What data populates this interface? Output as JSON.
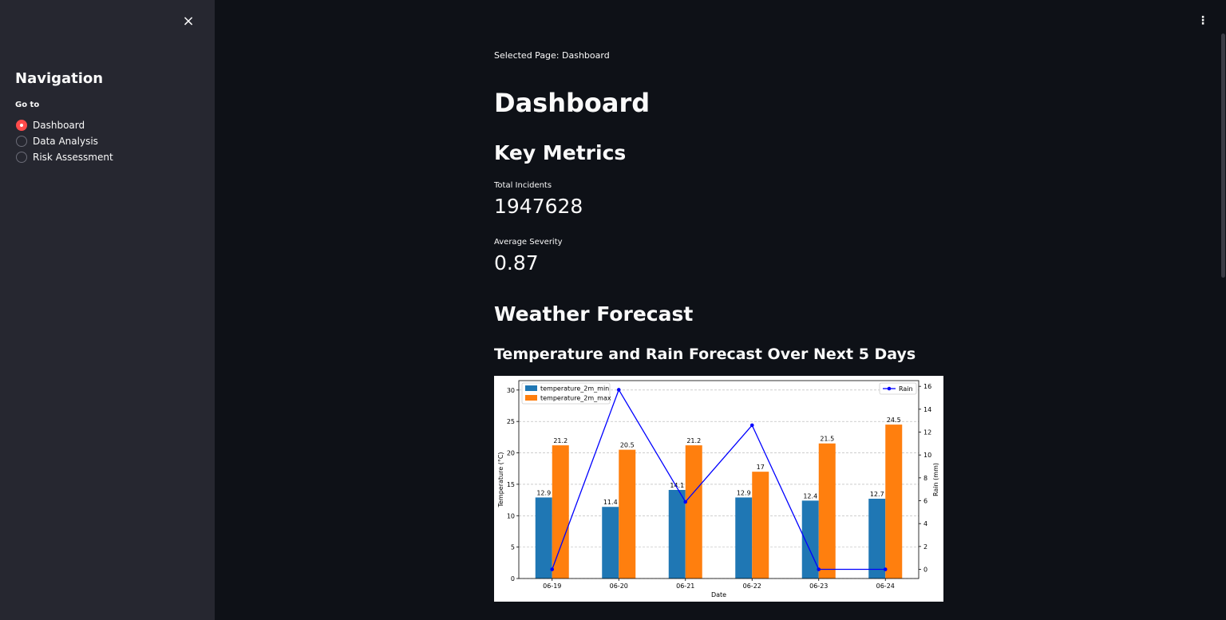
{
  "sidebar": {
    "close_icon": "×",
    "title": "Navigation",
    "goto_label": "Go to",
    "options": [
      {
        "label": "Dashboard",
        "selected": true
      },
      {
        "label": "Data Analysis",
        "selected": false
      },
      {
        "label": "Risk Assessment",
        "selected": false
      }
    ]
  },
  "header": {
    "menu_icon": "⋮"
  },
  "main": {
    "selected_page": "Selected Page: Dashboard",
    "title": "Dashboard",
    "key_metrics_heading": "Key Metrics",
    "metrics": [
      {
        "label": "Total Incidents",
        "value": "1947628"
      },
      {
        "label": "Average Severity",
        "value": "0.87"
      }
    ],
    "weather_heading": "Weather Forecast",
    "chart_heading": "Temperature and Rain Forecast Over Next 5 Days"
  },
  "colors": {
    "accent": "#ff4b4b",
    "temp_min": "#1f77b4",
    "temp_max": "#ff7f0e",
    "rain": "#0000ff"
  },
  "chart_data": {
    "type": "bar",
    "categories": [
      "06-19",
      "06-20",
      "06-21",
      "06-22",
      "06-23",
      "06-24"
    ],
    "series": [
      {
        "name": "temperature_2m_min",
        "values": [
          12.9,
          11.4,
          14.1,
          12.9,
          12.4,
          12.7
        ]
      },
      {
        "name": "temperature_2m_max",
        "values": [
          21.2,
          20.5,
          21.2,
          17,
          21.5,
          24.5
        ]
      }
    ],
    "bar_labels": [
      "12.9",
      "11.4",
      "14.1",
      "12.9",
      "12.4",
      "12.7",
      "21.2",
      "20.5",
      "21.2",
      "17",
      "21.5",
      "24.5"
    ],
    "secondary_series": {
      "name": "Rain",
      "type": "line",
      "values": [
        0,
        15.7,
        5.9,
        12.6,
        0,
        0
      ]
    },
    "xlabel": "Date",
    "ylabel": "Temperature (°C)",
    "y2label": "Rain (mm)",
    "ylim": [
      0,
      31.5
    ],
    "y2lim": [
      -0.8,
      16.5
    ],
    "yticks": [
      0,
      5,
      10,
      15,
      20,
      25,
      30
    ],
    "y2ticks": [
      0,
      2,
      4,
      6,
      8,
      10,
      12,
      14,
      16
    ],
    "grid": "horizontal",
    "legend_position": "top-left",
    "legend2_position": "top-right"
  }
}
